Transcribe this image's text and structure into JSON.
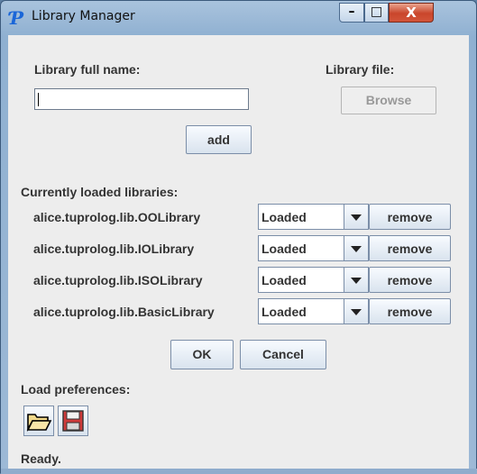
{
  "window": {
    "title": "Library Manager",
    "icon_glyph": "Ƥ",
    "minimize_glyph": "–",
    "maximize_glyph": "□",
    "close_glyph": "X"
  },
  "form": {
    "name_label": "Library full name:",
    "name_value": "",
    "file_label": "Library file:",
    "browse_label": "Browse",
    "add_label": "add"
  },
  "libraries": {
    "header": "Currently loaded libraries:",
    "items": [
      {
        "name": "alice.tuprolog.lib.OOLibrary",
        "status": "Loaded",
        "remove_label": "remove"
      },
      {
        "name": "alice.tuprolog.lib.IOLibrary",
        "status": "Loaded",
        "remove_label": "remove"
      },
      {
        "name": "alice.tuprolog.lib.ISOLibrary",
        "status": "Loaded",
        "remove_label": "remove"
      },
      {
        "name": "alice.tuprolog.lib.BasicLibrary",
        "status": "Loaded",
        "remove_label": "remove"
      }
    ]
  },
  "dialog": {
    "ok_label": "OK",
    "cancel_label": "Cancel"
  },
  "preferences": {
    "label": "Load preferences:",
    "open_icon": "folder-open-icon",
    "save_icon": "floppy-disk-icon"
  },
  "status": {
    "text": "Ready."
  }
}
